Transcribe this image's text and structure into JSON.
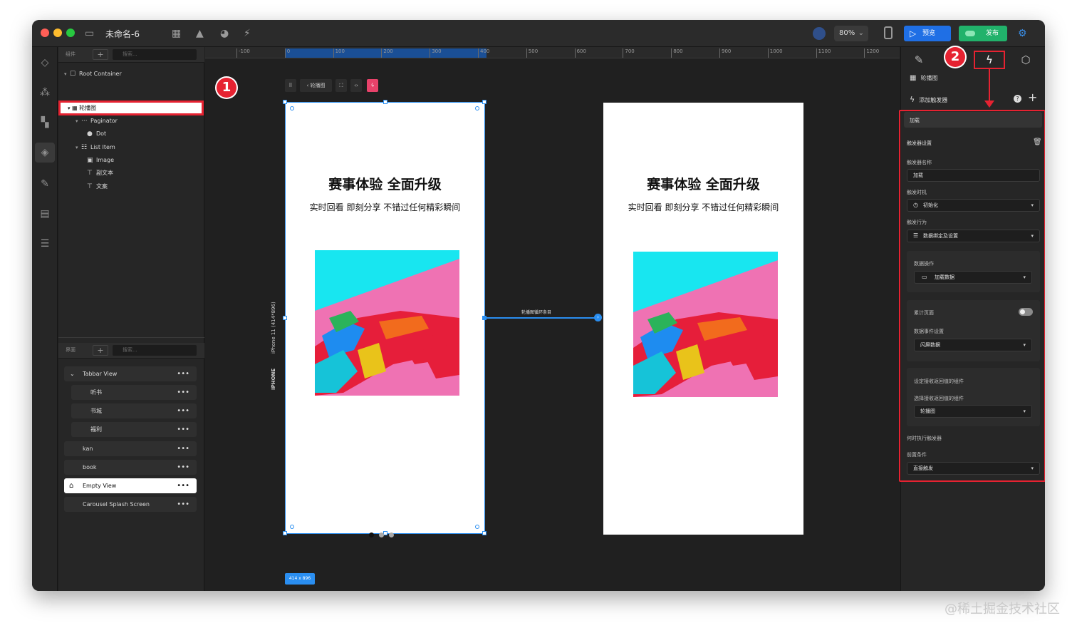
{
  "window": {
    "title": "未命名-6",
    "zoom": "80%",
    "preview_label": "预览",
    "publish_label": "发布"
  },
  "layer_panel": {
    "header_label": "组件",
    "search_placeholder": "搜索...",
    "tree": [
      {
        "label": "Root Container"
      },
      {
        "label": "轮播图"
      },
      {
        "label": "Paginator"
      },
      {
        "label": "Dot"
      },
      {
        "label": "List Item"
      },
      {
        "label": "Image"
      },
      {
        "label": "副文本"
      },
      {
        "label": "文案"
      }
    ]
  },
  "page_panel": {
    "header_label": "界面",
    "search_placeholder": "搜索...",
    "pages": [
      "Tabbar View",
      "听书",
      "书城",
      "福利",
      "kan",
      "book",
      "Empty View",
      "Carousel Splash Screen"
    ]
  },
  "canvas": {
    "ruler_ticks": [
      "-100",
      "0",
      "100",
      "200",
      "300",
      "400",
      "500",
      "600",
      "700",
      "800",
      "900",
      "1000",
      "1100",
      "1200"
    ],
    "toolbar_label": "轮播图",
    "phone_title": "赛事体验 全面升级",
    "phone_subtitle": "实时回看 即刻分享 不错过任何精彩瞬间",
    "device_label": "iPhone 11 (414*896)",
    "device_tag": "IPHONE",
    "size_label": "414 x 896",
    "link_label": "轮播图循环条目",
    "pager_dots": 3,
    "pager_active_index": 0
  },
  "annotations": {
    "badge_1": "1",
    "badge_2": "2"
  },
  "right_panel": {
    "component_name": "轮播图",
    "add_trigger": "添加触发器",
    "section_title": "加载",
    "trigger_settings": "触发器设置",
    "trigger_name_label": "触发器名称",
    "trigger_name_value": "加载",
    "trigger_time_label": "触发时机",
    "trigger_time_value": "初始化",
    "trigger_action_label": "触发行为",
    "trigger_action_value": "数据绑定及设置",
    "data_op_label": "数据操作",
    "data_op_value": "加载数据",
    "accumulate_label": "累计页面",
    "data_event_label": "数据事件设置",
    "data_event_value": "闪屏数据",
    "set_return_label": "设定接收返回值的组件",
    "choose_return_label": "选择接收返回值的组件",
    "choose_return_value": "轮播图",
    "when_run_label": "何时执行触发器",
    "precondition_label": "前置条件",
    "precondition_value": "直接触发"
  },
  "watermark": "@稀土掘金技术社区",
  "colors": {
    "accent_red": "#e62231",
    "selection_blue": "#2a8ef0",
    "preview_blue": "#1f6fe5",
    "publish_green": "#21b26b"
  }
}
